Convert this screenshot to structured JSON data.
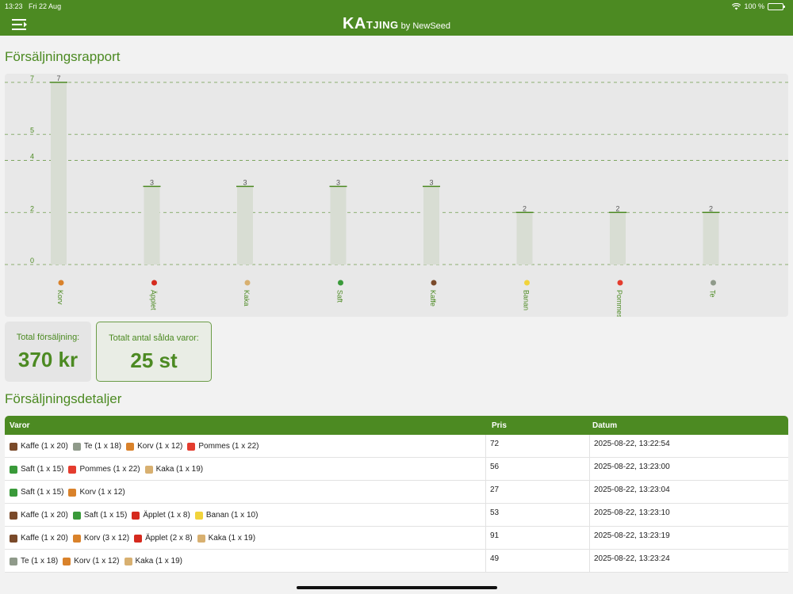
{
  "status_bar": {
    "time": "13:23",
    "date": "Fri 22 Aug",
    "battery": "100 %"
  },
  "app": {
    "brand_ka": "KA",
    "brand_tjing": "TJING",
    "brand_by": "by NewSeed"
  },
  "report": {
    "title": "Försäljningsrapport"
  },
  "chart_data": {
    "type": "bar",
    "title": "",
    "xlabel": "",
    "ylabel": "",
    "categories": [
      "Korv",
      "Äpplet",
      "Kaka",
      "Saft",
      "Kaffe",
      "Banan",
      "Pommes",
      "Te"
    ],
    "values": [
      7,
      3,
      3,
      3,
      3,
      2,
      2,
      2
    ],
    "ylim": [
      0,
      7
    ],
    "yticks": [
      0,
      2,
      4,
      5,
      7
    ],
    "grid": true,
    "bar_color": "#d8ddd3",
    "bar_top_color": "#4c8a22"
  },
  "summary": {
    "total_sales_label": "Total försäljning:",
    "total_sales_value": "370 kr",
    "total_items_label": "Totalt antal sålda varor:",
    "total_items_value": "25 st"
  },
  "details": {
    "title": "Försäljningsdetaljer",
    "columns": [
      "Varor",
      "Pris",
      "Datum"
    ],
    "rows": [
      {
        "items": [
          {
            "icon": "coffee-icon",
            "text": "Kaffe (1 x 20)"
          },
          {
            "icon": "tea-icon",
            "text": "Te (1 x 18)"
          },
          {
            "icon": "hotdog-icon",
            "text": "Korv (1 x 12)"
          },
          {
            "icon": "fries-icon",
            "text": "Pommes (1 x 22)"
          }
        ],
        "price": "72",
        "date": "2025-08-22, 13:22:54"
      },
      {
        "items": [
          {
            "icon": "juice-icon",
            "text": "Saft (1 x 15)"
          },
          {
            "icon": "fries-icon",
            "text": "Pommes (1 x 22)"
          },
          {
            "icon": "cake-icon",
            "text": "Kaka (1 x 19)"
          }
        ],
        "price": "56",
        "date": "2025-08-22, 13:23:00"
      },
      {
        "items": [
          {
            "icon": "juice-icon",
            "text": "Saft (1 x 15)"
          },
          {
            "icon": "hotdog-icon",
            "text": "Korv (1 x 12)"
          }
        ],
        "price": "27",
        "date": "2025-08-22, 13:23:04"
      },
      {
        "items": [
          {
            "icon": "coffee-icon",
            "text": "Kaffe (1 x 20)"
          },
          {
            "icon": "juice-icon",
            "text": "Saft (1 x 15)"
          },
          {
            "icon": "apple-icon",
            "text": "Äpplet (1 x 8)"
          },
          {
            "icon": "banana-icon",
            "text": "Banan (1 x 10)"
          }
        ],
        "price": "53",
        "date": "2025-08-22, 13:23:10"
      },
      {
        "items": [
          {
            "icon": "coffee-icon",
            "text": "Kaffe (1 x 20)"
          },
          {
            "icon": "hotdog-icon",
            "text": "Korv (3 x 12)"
          },
          {
            "icon": "apple-icon",
            "text": "Äpplet (2 x 8)"
          },
          {
            "icon": "cake-icon",
            "text": "Kaka (1 x 19)"
          }
        ],
        "price": "91",
        "date": "2025-08-22, 13:23:19"
      },
      {
        "items": [
          {
            "icon": "tea-icon",
            "text": "Te (1 x 18)"
          },
          {
            "icon": "hotdog-icon",
            "text": "Korv (1 x 12)"
          },
          {
            "icon": "cake-icon",
            "text": "Kaka (1 x 19)"
          }
        ],
        "price": "49",
        "date": "2025-08-22, 13:23:24"
      }
    ]
  },
  "colors": {
    "primary": "#4c8a22"
  }
}
